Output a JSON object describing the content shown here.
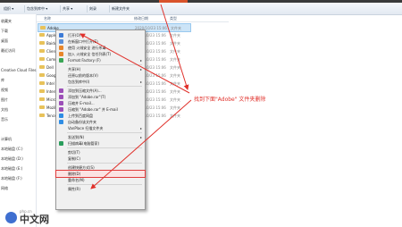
{
  "toolbar": {
    "items": [
      "组织 ▾",
      "包含到库中 ▾",
      "共享 ▾",
      "刻录",
      "新建文件夹"
    ],
    "accent_color": "#d9532b"
  },
  "sidebar": {
    "items": [
      "收藏夹",
      "下载",
      "桌面",
      "最近访问",
      "",
      "Creative Cloud Files",
      "库",
      "视频",
      "图片",
      "文档",
      "音乐",
      "",
      "计算机",
      "本地磁盘 (C:)",
      "本地磁盘 (D:)",
      "本地磁盘 (E:)",
      "本地磁盘 (F:)",
      "网络"
    ]
  },
  "columns": [
    "名称",
    "修改日期",
    "类型"
  ],
  "files": [
    {
      "name": "Adobe",
      "date": "2020/10/23 15:06",
      "type": "文件夹",
      "selected": true
    },
    {
      "name": "Apple",
      "date": "2020/10/23 15:06",
      "type": "文件夹"
    },
    {
      "name": "Baidu",
      "date": "2020/10/23 15:06",
      "type": "文件夹"
    },
    {
      "name": "ClientAgent",
      "date": "2020/10/23 15:06",
      "type": "文件夹"
    },
    {
      "name": "Common Files",
      "date": "2020/10/23 15:06",
      "type": "文件夹"
    },
    {
      "name": "Dell",
      "date": "2020/10/23 15:06",
      "type": "文件夹"
    },
    {
      "name": "Google",
      "date": "2020/10/23 15:06",
      "type": "文件夹"
    },
    {
      "name": "Intel",
      "date": "2020/10/23 15:06",
      "type": "文件夹"
    },
    {
      "name": "Internet Explorer",
      "date": "2020/10/23 15:06",
      "type": "文件夹"
    },
    {
      "name": "Microsoft",
      "date": "2020/10/23 15:06",
      "type": "文件夹"
    },
    {
      "name": "Mozilla",
      "date": "2020/10/23 15:06",
      "type": "文件夹"
    },
    {
      "name": "Tencent",
      "date": "2020/10/23 15:06",
      "type": "文件夹"
    }
  ],
  "context_menu": {
    "items": [
      {
        "label": "打开(O)",
        "icon": "open-icon"
      },
      {
        "label": "在新窗口中打开(E)",
        "icon": "window-icon"
      },
      {
        "label": "使用 火绒安全 进行杀毒",
        "icon": "shield-icon"
      },
      {
        "label": "加入 火绒安全 信任列表(T)",
        "icon": "shield-icon"
      },
      {
        "label": "Format Factory (F)",
        "icon": "format-icon",
        "submenu": true
      },
      {
        "sep": true
      },
      {
        "label": "共享(H)",
        "icon": "",
        "submenu": true
      },
      {
        "label": "还原以前的版本(V)",
        "icon": ""
      },
      {
        "label": "包含到库中(I)",
        "icon": "",
        "submenu": true
      },
      {
        "sep": true
      },
      {
        "label": "添加到压缩文件(A)...",
        "icon": "archive-icon"
      },
      {
        "label": "添加到 \"Adobe.rar\"(T)",
        "icon": "archive-icon"
      },
      {
        "label": "压缩并 E-mail...",
        "icon": "archive-icon"
      },
      {
        "label": "压缩到 \"Adobe.rar\" 并 E-mail",
        "icon": "archive-icon"
      },
      {
        "label": "上传到百度网盘",
        "icon": "cloud-icon"
      },
      {
        "label": "自动备份该文件夹",
        "icon": "cloud-icon"
      },
      {
        "label": "VanPlace 扫描文件夹",
        "icon": "",
        "submenu": true
      },
      {
        "sep": true
      },
      {
        "label": "发送到(N)",
        "icon": "",
        "submenu": true
      },
      {
        "label": "扫描病毒(电脑管家)",
        "icon": "scan-icon"
      },
      {
        "sep": true
      },
      {
        "label": "剪切(T)",
        "icon": ""
      },
      {
        "label": "复制(C)",
        "icon": ""
      },
      {
        "sep": true
      },
      {
        "label": "创建快捷方式(S)",
        "icon": ""
      },
      {
        "label": "删除(D)",
        "icon": "",
        "highlight": true
      },
      {
        "label": "重命名(M)",
        "icon": ""
      },
      {
        "sep": true
      },
      {
        "label": "属性(R)",
        "icon": ""
      }
    ],
    "highlight_color": "#e03c3c"
  },
  "annotation": {
    "text": "找到下面\"Adobe\" 文件夹删除",
    "color": "#e0312b"
  },
  "watermark": {
    "text": "中文网",
    "domain": "php.cn",
    "icon": "php-logo-icon"
  }
}
